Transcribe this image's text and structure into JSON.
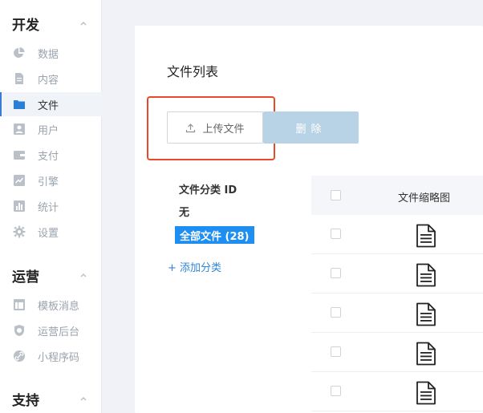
{
  "sidebar": {
    "sections": [
      {
        "title": "开发",
        "items": [
          {
            "label": "数据",
            "icon": "pie-chart-icon"
          },
          {
            "label": "内容",
            "icon": "document-icon"
          },
          {
            "label": "文件",
            "icon": "folder-icon",
            "active": true
          },
          {
            "label": "用户",
            "icon": "user-icon"
          },
          {
            "label": "支付",
            "icon": "wallet-icon"
          },
          {
            "label": "引擎",
            "icon": "trend-icon"
          },
          {
            "label": "统计",
            "icon": "bar-chart-icon"
          },
          {
            "label": "设置",
            "icon": "gear-icon"
          }
        ]
      },
      {
        "title": "运营",
        "items": [
          {
            "label": "模板消息",
            "icon": "template-icon"
          },
          {
            "label": "运营后台",
            "icon": "shield-icon"
          },
          {
            "label": "小程序码",
            "icon": "link-icon"
          }
        ]
      },
      {
        "title": "支持",
        "items": []
      }
    ]
  },
  "main": {
    "title": "文件列表",
    "upload_label": "上传文件",
    "delete_label": "删除",
    "categories": {
      "heading": "文件分类 ID",
      "none_label": "无",
      "all_label": "全部文件 (28)",
      "add_label": "+ 添加分类"
    },
    "table": {
      "thumbnail_header": "文件缩略图",
      "row_count": 5
    }
  },
  "colors": {
    "accent": "#1e8ef0",
    "active_indicator": "#3a7bd5",
    "delete_button": "#b9d3e6",
    "highlight": "#e8492b",
    "link": "#2f86d8"
  }
}
